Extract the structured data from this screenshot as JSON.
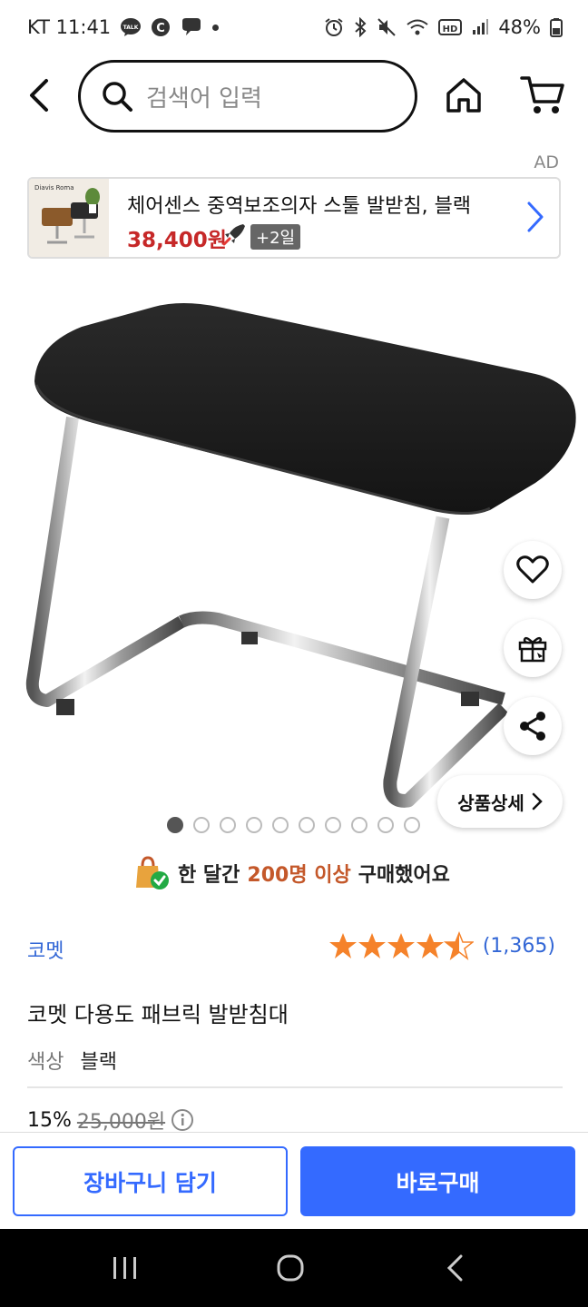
{
  "status_bar": {
    "carrier_time": "KT 11:41",
    "talk_badge": "TALK",
    "c_badge": "C",
    "hd_badge": "HD",
    "battery": "48%"
  },
  "header": {
    "search_placeholder": "검색어 입력"
  },
  "ad": {
    "label": "AD",
    "thumb_brand": "Diavis Roma",
    "title": "체어센스 중역보조의자 스툴 발받침, 블랙",
    "price": "38,400원",
    "delivery_badge": "+2일"
  },
  "gallery": {
    "pages": 10,
    "active_page": 1,
    "detail_button": "상품상세"
  },
  "social_proof": {
    "prefix": "한 달간",
    "highlight": "200명 이상",
    "suffix": "구매했어요"
  },
  "product": {
    "brand": "코멧",
    "rating": 4.5,
    "review_count": "(1,365)",
    "title": "코멧 다용도 패브릭 발받침대",
    "option_label": "색상",
    "option_value": "블랙",
    "discount": "15%",
    "original_price": "25,000원"
  },
  "actions": {
    "add_to_cart": "장바구니 담기",
    "buy_now": "바로구매"
  },
  "colors": {
    "accent_blue": "#346aff",
    "link_blue": "#3367d6",
    "ad_price_red": "#c62828",
    "star_orange": "#f5822a",
    "highlight_orange": "#c4582a"
  }
}
